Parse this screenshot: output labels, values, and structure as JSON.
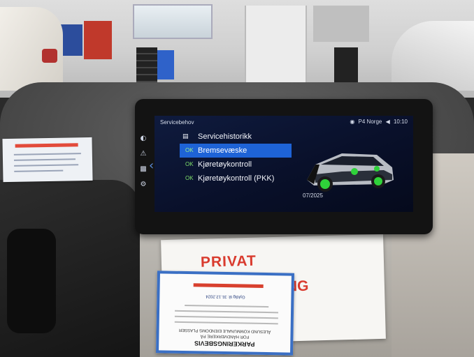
{
  "screen": {
    "section_title": "Servicebehov",
    "status": {
      "radio_station": "P4 Norge",
      "time": "10:10"
    },
    "menu": [
      {
        "label": "Servicehistorikk",
        "status": "",
        "selected": false,
        "icon": "car-history-icon"
      },
      {
        "label": "Bremsevæske",
        "status": "OK",
        "selected": true
      },
      {
        "label": "Kjøretøykontroll",
        "status": "OK",
        "selected": false
      },
      {
        "label": "Kjøretøykontroll (PKK)",
        "status": "OK",
        "selected": false
      }
    ],
    "due_date": "07/2025",
    "side_icons": [
      "tire-pressure-icon",
      "warning-icon",
      "car-service-icon",
      "wrench-icon"
    ],
    "accent_color": "#1e63d6",
    "ok_color": "#7fe06a"
  },
  "sign": {
    "text_top": "PRIVAT",
    "text_partial": "NG"
  },
  "permit": {
    "title": "PARKERINGSBEVIS",
    "subtitle": "FOR HÅNDVERKERE PÅ",
    "subtitle2": "ÅLESUND KOMMUNALE EIENDOMS PLASSER",
    "valid_until": "Gyldig til: 31.12.2024"
  }
}
